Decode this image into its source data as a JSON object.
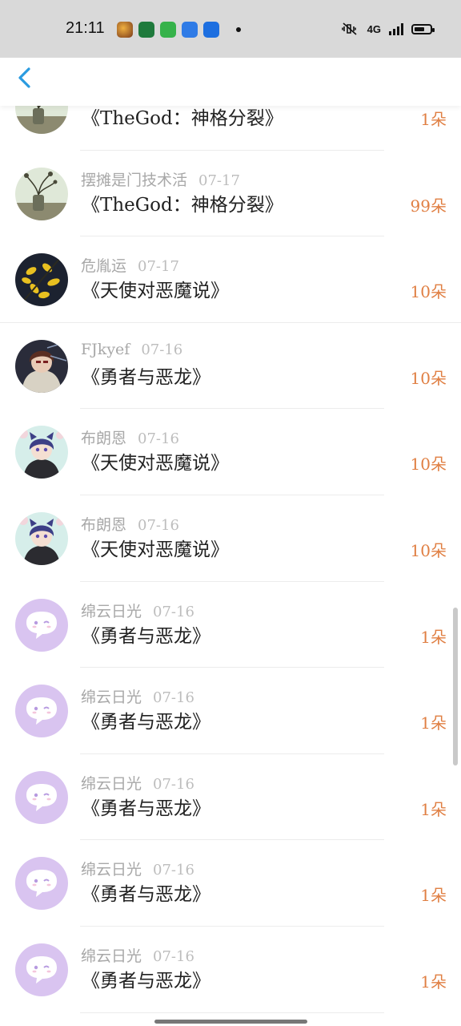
{
  "status_bar": {
    "time": "21:11",
    "network": "4G",
    "app_icons": [
      "game-app-icon",
      "oppo-app-icon",
      "wechat-mini-icon",
      "cloud-app-icon",
      "text-app-icon"
    ]
  },
  "header": {
    "back_icon": "chevron-left-icon"
  },
  "colors": {
    "accent": "#2a9be0",
    "amount": "#e07f43",
    "meta": "#a8a8a8"
  },
  "records": [
    {
      "user": "",
      "date": "",
      "title": "《TheGod：神格分裂》",
      "amount": "1朵",
      "avatar": "vase-photo"
    },
    {
      "user": "摆摊是门技术活",
      "date": "07-17",
      "title": "《TheGod：神格分裂》",
      "amount": "99朵",
      "avatar": "vase-photo"
    },
    {
      "user": "危胤运",
      "date": "07-17",
      "title": "《天使对恶魔说》",
      "amount": "10朵",
      "avatar": "yellow-flowers"
    },
    {
      "user": "FJkyef",
      "date": "07-16",
      "title": "《勇者与恶龙》",
      "amount": "10朵",
      "avatar": "anime-boy"
    },
    {
      "user": "布朗恩",
      "date": "07-16",
      "title": "《天使对恶魔说》",
      "amount": "10朵",
      "avatar": "anime-catgirl"
    },
    {
      "user": "布朗恩",
      "date": "07-16",
      "title": "《天使对恶魔说》",
      "amount": "10朵",
      "avatar": "anime-catgirl"
    },
    {
      "user": "绵云日光",
      "date": "07-16",
      "title": "《勇者与恶龙》",
      "amount": "1朵",
      "avatar": "default-purple"
    },
    {
      "user": "绵云日光",
      "date": "07-16",
      "title": "《勇者与恶龙》",
      "amount": "1朵",
      "avatar": "default-purple"
    },
    {
      "user": "绵云日光",
      "date": "07-16",
      "title": "《勇者与恶龙》",
      "amount": "1朵",
      "avatar": "default-purple"
    },
    {
      "user": "绵云日光",
      "date": "07-16",
      "title": "《勇者与恶龙》",
      "amount": "1朵",
      "avatar": "default-purple"
    },
    {
      "user": "绵云日光",
      "date": "07-16",
      "title": "《勇者与恶龙》",
      "amount": "1朵",
      "avatar": "default-purple"
    }
  ]
}
